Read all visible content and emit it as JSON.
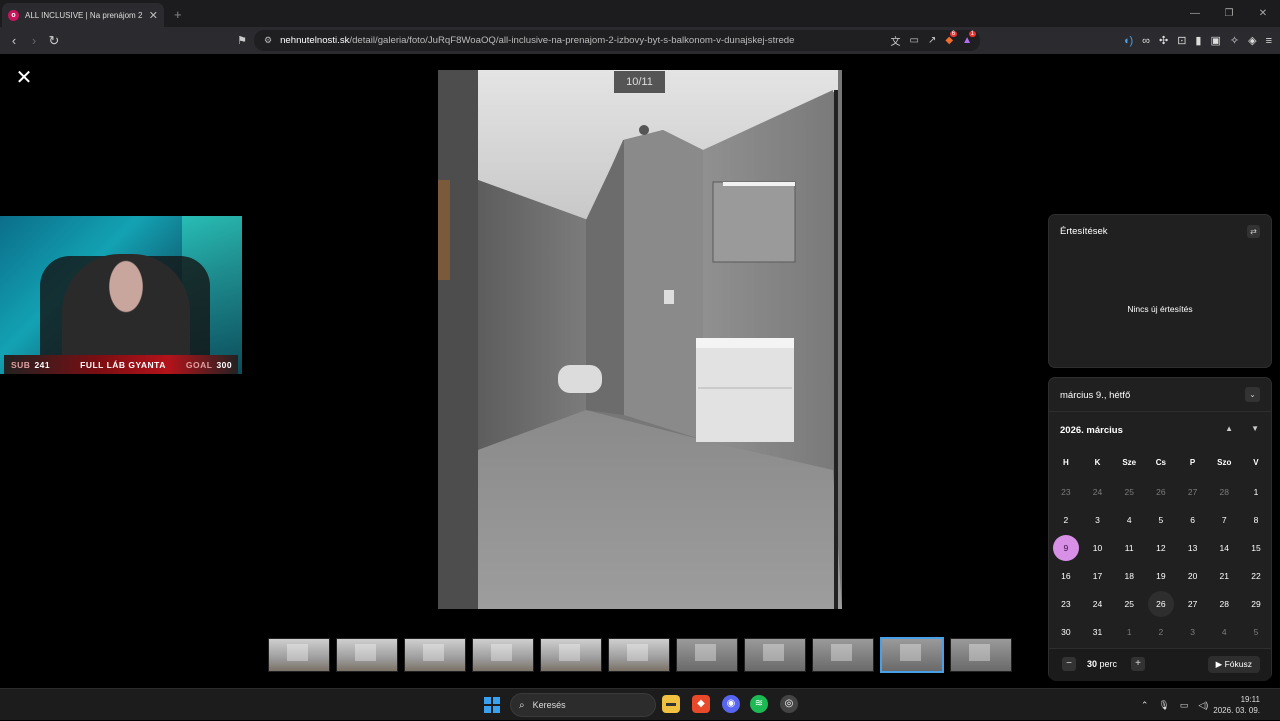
{
  "browser": {
    "tab_title": "ALL INCLUSIVE | Na prenájom 2",
    "tab_favicon": "o",
    "url_host": "nehnutelnosti.sk",
    "url_path": "/detail/galeria/foto/JuRqF8WoaOQ/all-inclusive-na-prenajom-2-izbovy-byt-s-balkonom-v-dunajskej-strede",
    "shield_badge": "6",
    "rewards_badge": "1"
  },
  "gallery": {
    "counter": "10/11",
    "thumbnail_count": 11,
    "active_index": 9
  },
  "stream": {
    "sub_label": "SUB",
    "sub_value": "241",
    "title": "FULL LÁB GYANTA",
    "goal_label": "GOAL",
    "goal_value": "300"
  },
  "notifications": {
    "header": "Értesítések",
    "empty": "Nincs új értesítés"
  },
  "calendar": {
    "date_label": "március 9., hétfő",
    "month_label": "2026. március",
    "weekdays": [
      "H",
      "K",
      "Sze",
      "Cs",
      "P",
      "Szo",
      "V"
    ],
    "days": [
      {
        "d": "23",
        "o": true
      },
      {
        "d": "24",
        "o": true
      },
      {
        "d": "25",
        "o": true
      },
      {
        "d": "26",
        "o": true
      },
      {
        "d": "27",
        "o": true
      },
      {
        "d": "28",
        "o": true
      },
      {
        "d": "1"
      },
      {
        "d": "2"
      },
      {
        "d": "3"
      },
      {
        "d": "4"
      },
      {
        "d": "5"
      },
      {
        "d": "6"
      },
      {
        "d": "7"
      },
      {
        "d": "8"
      },
      {
        "d": "9",
        "today": true
      },
      {
        "d": "10"
      },
      {
        "d": "11"
      },
      {
        "d": "12"
      },
      {
        "d": "13"
      },
      {
        "d": "14"
      },
      {
        "d": "15"
      },
      {
        "d": "16"
      },
      {
        "d": "17"
      },
      {
        "d": "18"
      },
      {
        "d": "19"
      },
      {
        "d": "20"
      },
      {
        "d": "21"
      },
      {
        "d": "22"
      },
      {
        "d": "23"
      },
      {
        "d": "24"
      },
      {
        "d": "25"
      },
      {
        "d": "26",
        "hover": true
      },
      {
        "d": "27"
      },
      {
        "d": "28"
      },
      {
        "d": "29"
      },
      {
        "d": "30"
      },
      {
        "d": "31"
      },
      {
        "d": "1",
        "o": true
      },
      {
        "d": "2",
        "o": true
      },
      {
        "d": "3",
        "o": true
      },
      {
        "d": "4",
        "o": true
      },
      {
        "d": "5",
        "o": true
      }
    ],
    "focus_minutes": "30",
    "focus_unit": "perc",
    "focus_button": "Fókusz"
  },
  "taskbar": {
    "search_label": "Keresés",
    "time": "19:11",
    "date": "2026. 03. 09."
  }
}
